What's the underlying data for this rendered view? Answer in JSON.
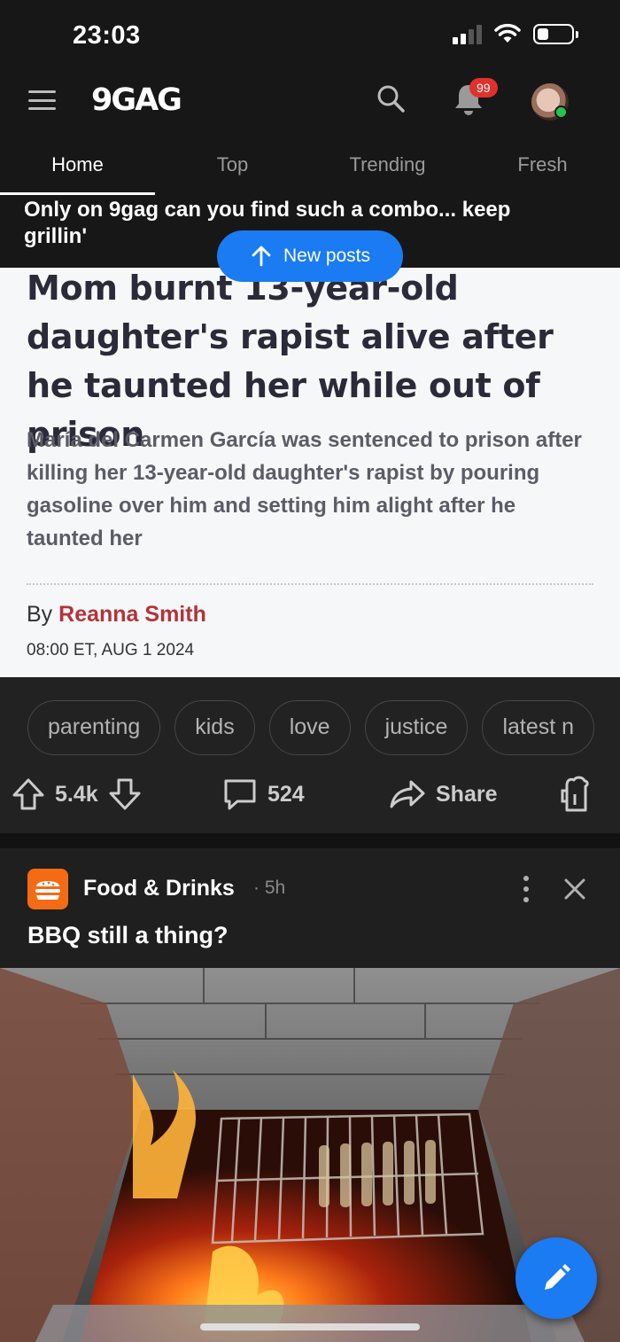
{
  "status_bar": {
    "time": "23:03"
  },
  "header": {
    "logo": "9GAG",
    "notification_count": "99"
  },
  "tabs": [
    {
      "label": "Home",
      "active": true
    },
    {
      "label": "Top",
      "active": false
    },
    {
      "label": "Trending",
      "active": false
    },
    {
      "label": "Fresh",
      "active": false
    }
  ],
  "post1": {
    "title": "Only on 9gag can you find such a combo... keep grillin'",
    "new_posts_label": "New posts",
    "article": {
      "headline": "Mom burnt 13-year-old daughter's rapist alive after he taunted her while out of prison",
      "summary": "María del Carmen García was sentenced to prison after killing her 13-year-old daughter's rapist by pouring gasoline over him and setting him alight after he taunted her",
      "byline_prefix": "By",
      "author": "Reanna Smith",
      "date": "08:00 ET, AUG 1 2024"
    },
    "tags": [
      "parenting",
      "kids",
      "love",
      "justice",
      "latest n"
    ],
    "upvotes": "5.4k",
    "comments": "524",
    "share_label": "Share"
  },
  "post2": {
    "section": "Food & Drinks",
    "time_ago": "· 5h",
    "title": "BBQ still a thing?"
  },
  "colors": {
    "accent": "#1a7bf2",
    "badge": "#e0312c",
    "author": "#b3333a",
    "section_icon": "#f36b15",
    "online": "#26c152"
  }
}
